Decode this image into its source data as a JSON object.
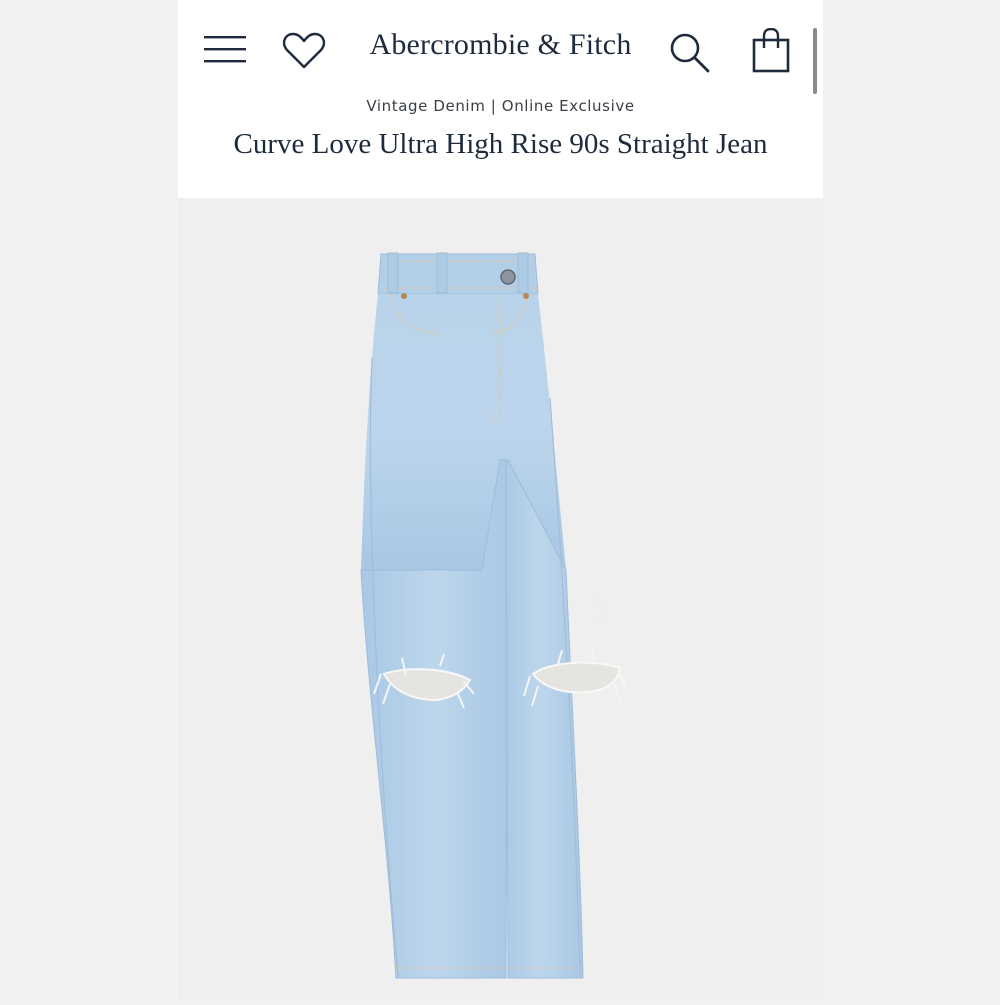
{
  "header": {
    "brand": "Abercrombie & Fitch",
    "subtitle": "Vintage Denim | Online Exclusive",
    "product_title": "Curve Love Ultra High Rise 90s Straight Jean",
    "icons": [
      "menu-icon",
      "heart-icon",
      "search-icon",
      "shopping-bag-icon"
    ]
  },
  "colors": {
    "text_dark": "#1e2b3d",
    "denim_light": "#b9d3ea",
    "denim_mid": "#a6c6e4",
    "background": "#efefef"
  }
}
